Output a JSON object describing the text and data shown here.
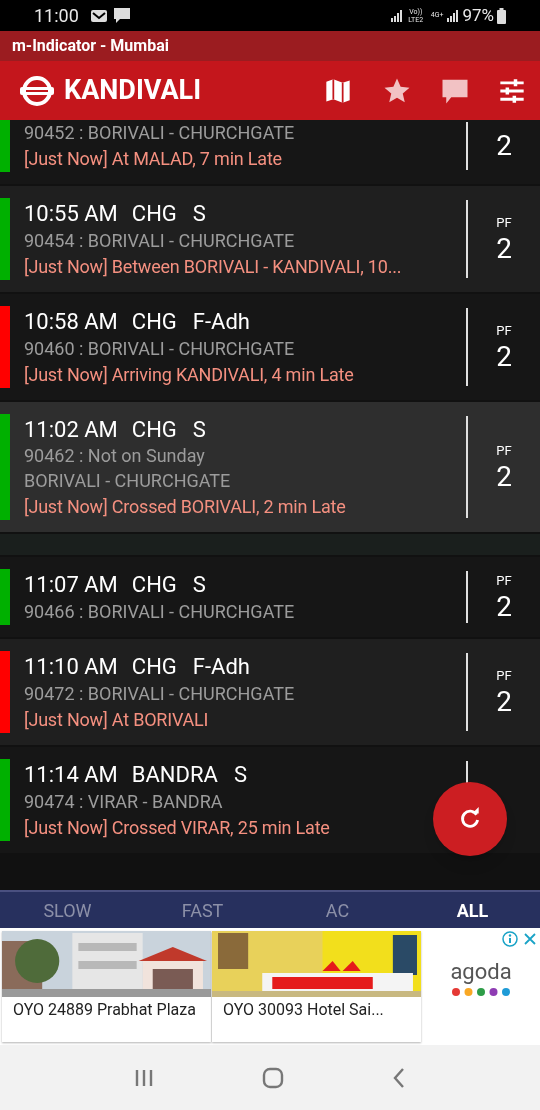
{
  "status_bar": {
    "time": "11:00",
    "network_label": "Vo)) LTE2",
    "data_label": "4G+",
    "battery": "97%"
  },
  "app_title": "m-Indicator - Mumbai",
  "header": {
    "station": "KANDIVALI"
  },
  "trains": [
    {
      "route": "90452 : BORIVALI - CHURCHGATE",
      "status": "[Just Now] At MALAD, 7 min Late",
      "pf": "2",
      "color": "#00b000",
      "highlighted": false
    },
    {
      "time": "10:55 AM",
      "dest": "CHG",
      "type": "S",
      "route": "90454 : BORIVALI - CHURCHGATE",
      "status": "[Just Now] Between BORIVALI - KANDIVALI, 10...",
      "pf_label": "PF",
      "pf": "2",
      "color": "#00b000",
      "highlighted": false
    },
    {
      "time": "10:58 AM",
      "dest": "CHG",
      "type": "F-Adh",
      "route": "90460 : BORIVALI - CHURCHGATE",
      "status": "[Just Now] Arriving KANDIVALI, 4 min Late",
      "pf_label": "PF",
      "pf": "2",
      "color": "#ff0000",
      "highlighted": false
    },
    {
      "time": "11:02 AM",
      "dest": "CHG",
      "type": "S",
      "note": "90462 : Not on Sunday",
      "route": "BORIVALI - CHURCHGATE",
      "status": "[Just Now] Crossed BORIVALI, 2 min Late",
      "pf_label": "PF",
      "pf": "2",
      "color": "#00b000",
      "highlighted": true
    },
    {
      "time": "11:07 AM",
      "dest": "CHG",
      "type": "S",
      "route": "90466 : BORIVALI - CHURCHGATE",
      "pf_label": "PF",
      "pf": "2",
      "color": "#00b000",
      "highlighted": false
    },
    {
      "time": "11:10 AM",
      "dest": "CHG",
      "type": "F-Adh",
      "route": "90472 : BORIVALI - CHURCHGATE",
      "status": "[Just Now] At BORIVALI",
      "pf_label": "PF",
      "pf": "2",
      "color": "#ff0000",
      "highlighted": false
    },
    {
      "time": "11:14 AM",
      "dest": "BANDRA",
      "type": "S",
      "route": "90474 : VIRAR - BANDRA",
      "status": "[Just Now] Crossed VIRAR, 25 min Late",
      "color": "#00b000",
      "highlighted": false
    }
  ],
  "tabs": [
    {
      "label": "SLOW",
      "selected": false
    },
    {
      "label": "FAST",
      "selected": false
    },
    {
      "label": "AC",
      "selected": false
    },
    {
      "label": "ALL",
      "selected": true
    }
  ],
  "ad": {
    "cards": [
      {
        "title": "OYO 24889 Prabhat Plaza",
        "kind": "building"
      },
      {
        "title": "OYO 30093 Hotel Sai...",
        "kind": "bedroom"
      }
    ],
    "brand": "agoda"
  }
}
